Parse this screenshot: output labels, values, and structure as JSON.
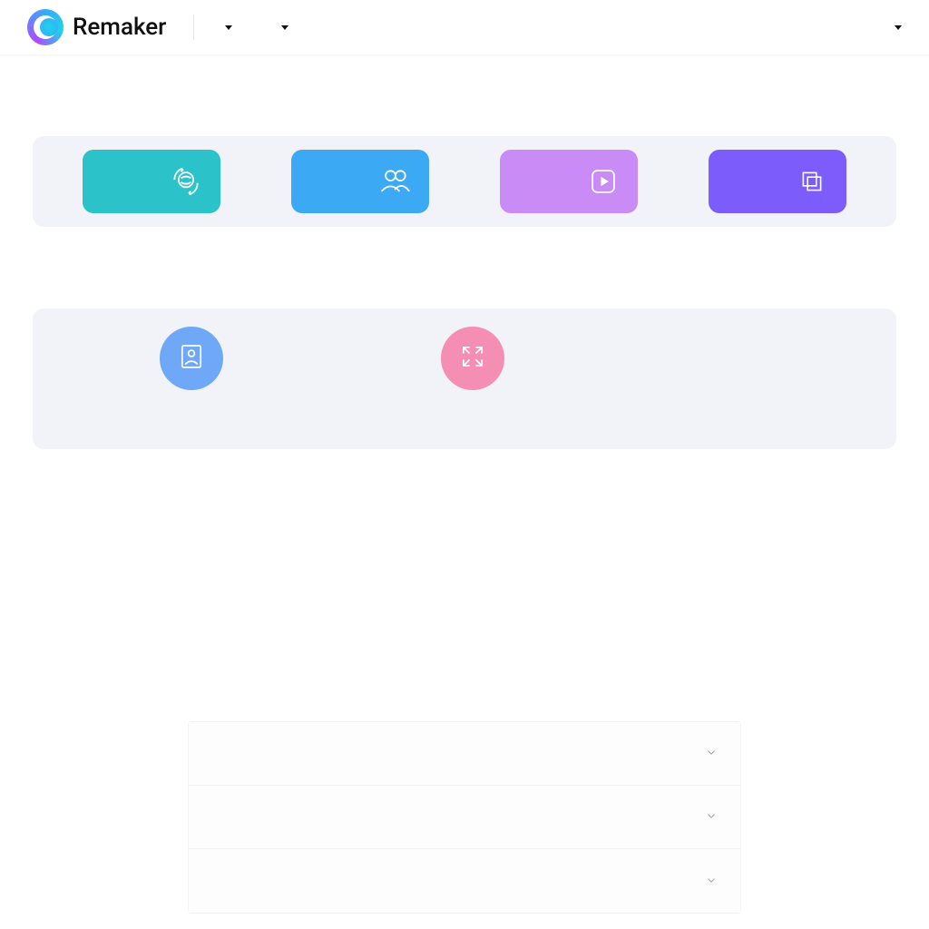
{
  "header": {
    "brand": "Remaker",
    "nav": [
      {
        "label": ""
      },
      {
        "label": ""
      }
    ],
    "lang_label": ""
  },
  "top_cards": [
    {
      "icon": "face-swap-icon",
      "color": "#2bc3c9"
    },
    {
      "icon": "users-icon",
      "color": "#3ca9f5"
    },
    {
      "icon": "play-icon",
      "color": "#c98bf5"
    },
    {
      "icon": "stack-icon",
      "color": "#7c5cfa"
    }
  ],
  "feature_circles": [
    {
      "icon": "person-card-icon",
      "color": "#6ea8f7"
    },
    {
      "icon": "expand-icon",
      "color": "#f48eb2"
    }
  ],
  "accordion": [
    {
      "title": ""
    },
    {
      "title": ""
    },
    {
      "title": ""
    }
  ]
}
